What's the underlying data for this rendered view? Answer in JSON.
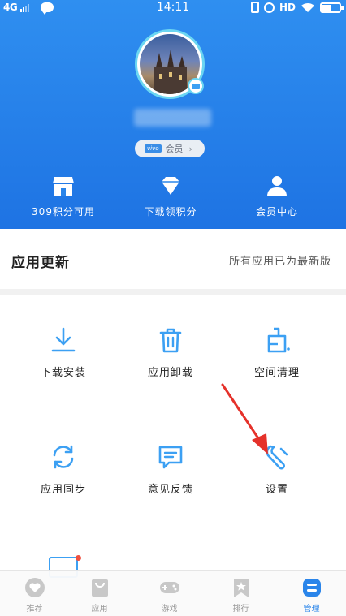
{
  "status_bar": {
    "network": "4G",
    "time": "14:11",
    "hd": "HD"
  },
  "profile": {
    "vip_label": "会员",
    "vivo_tag": "vivo"
  },
  "stats": [
    {
      "label": "309积分可用",
      "icon": "store-icon"
    },
    {
      "label": "下载领积分",
      "icon": "diamond-icon"
    },
    {
      "label": "会员中心",
      "icon": "person-icon"
    }
  ],
  "updates": {
    "title": "应用更新",
    "status": "所有应用已为最新版"
  },
  "tiles": [
    {
      "label": "下载安装",
      "icon": "download-icon"
    },
    {
      "label": "应用卸载",
      "icon": "trash-icon"
    },
    {
      "label": "空间清理",
      "icon": "brush-icon"
    },
    {
      "label": "应用同步",
      "icon": "sync-icon"
    },
    {
      "label": "意见反馈",
      "icon": "feedback-icon"
    },
    {
      "label": "设置",
      "icon": "wrench-icon"
    }
  ],
  "bottom_nav": [
    {
      "label": "推荐",
      "icon": "heart-icon",
      "active": false
    },
    {
      "label": "应用",
      "icon": "bag-icon",
      "active": false
    },
    {
      "label": "游戏",
      "icon": "gamepad-icon",
      "active": false
    },
    {
      "label": "排行",
      "icon": "bookmark-icon",
      "active": false
    },
    {
      "label": "管理",
      "icon": "manage-icon",
      "active": true
    }
  ],
  "colors": {
    "header_blue": "#2a85ea",
    "accent": "#3ca0f3",
    "annotation": "#e5312a",
    "active_nav": "#2a85ea"
  }
}
